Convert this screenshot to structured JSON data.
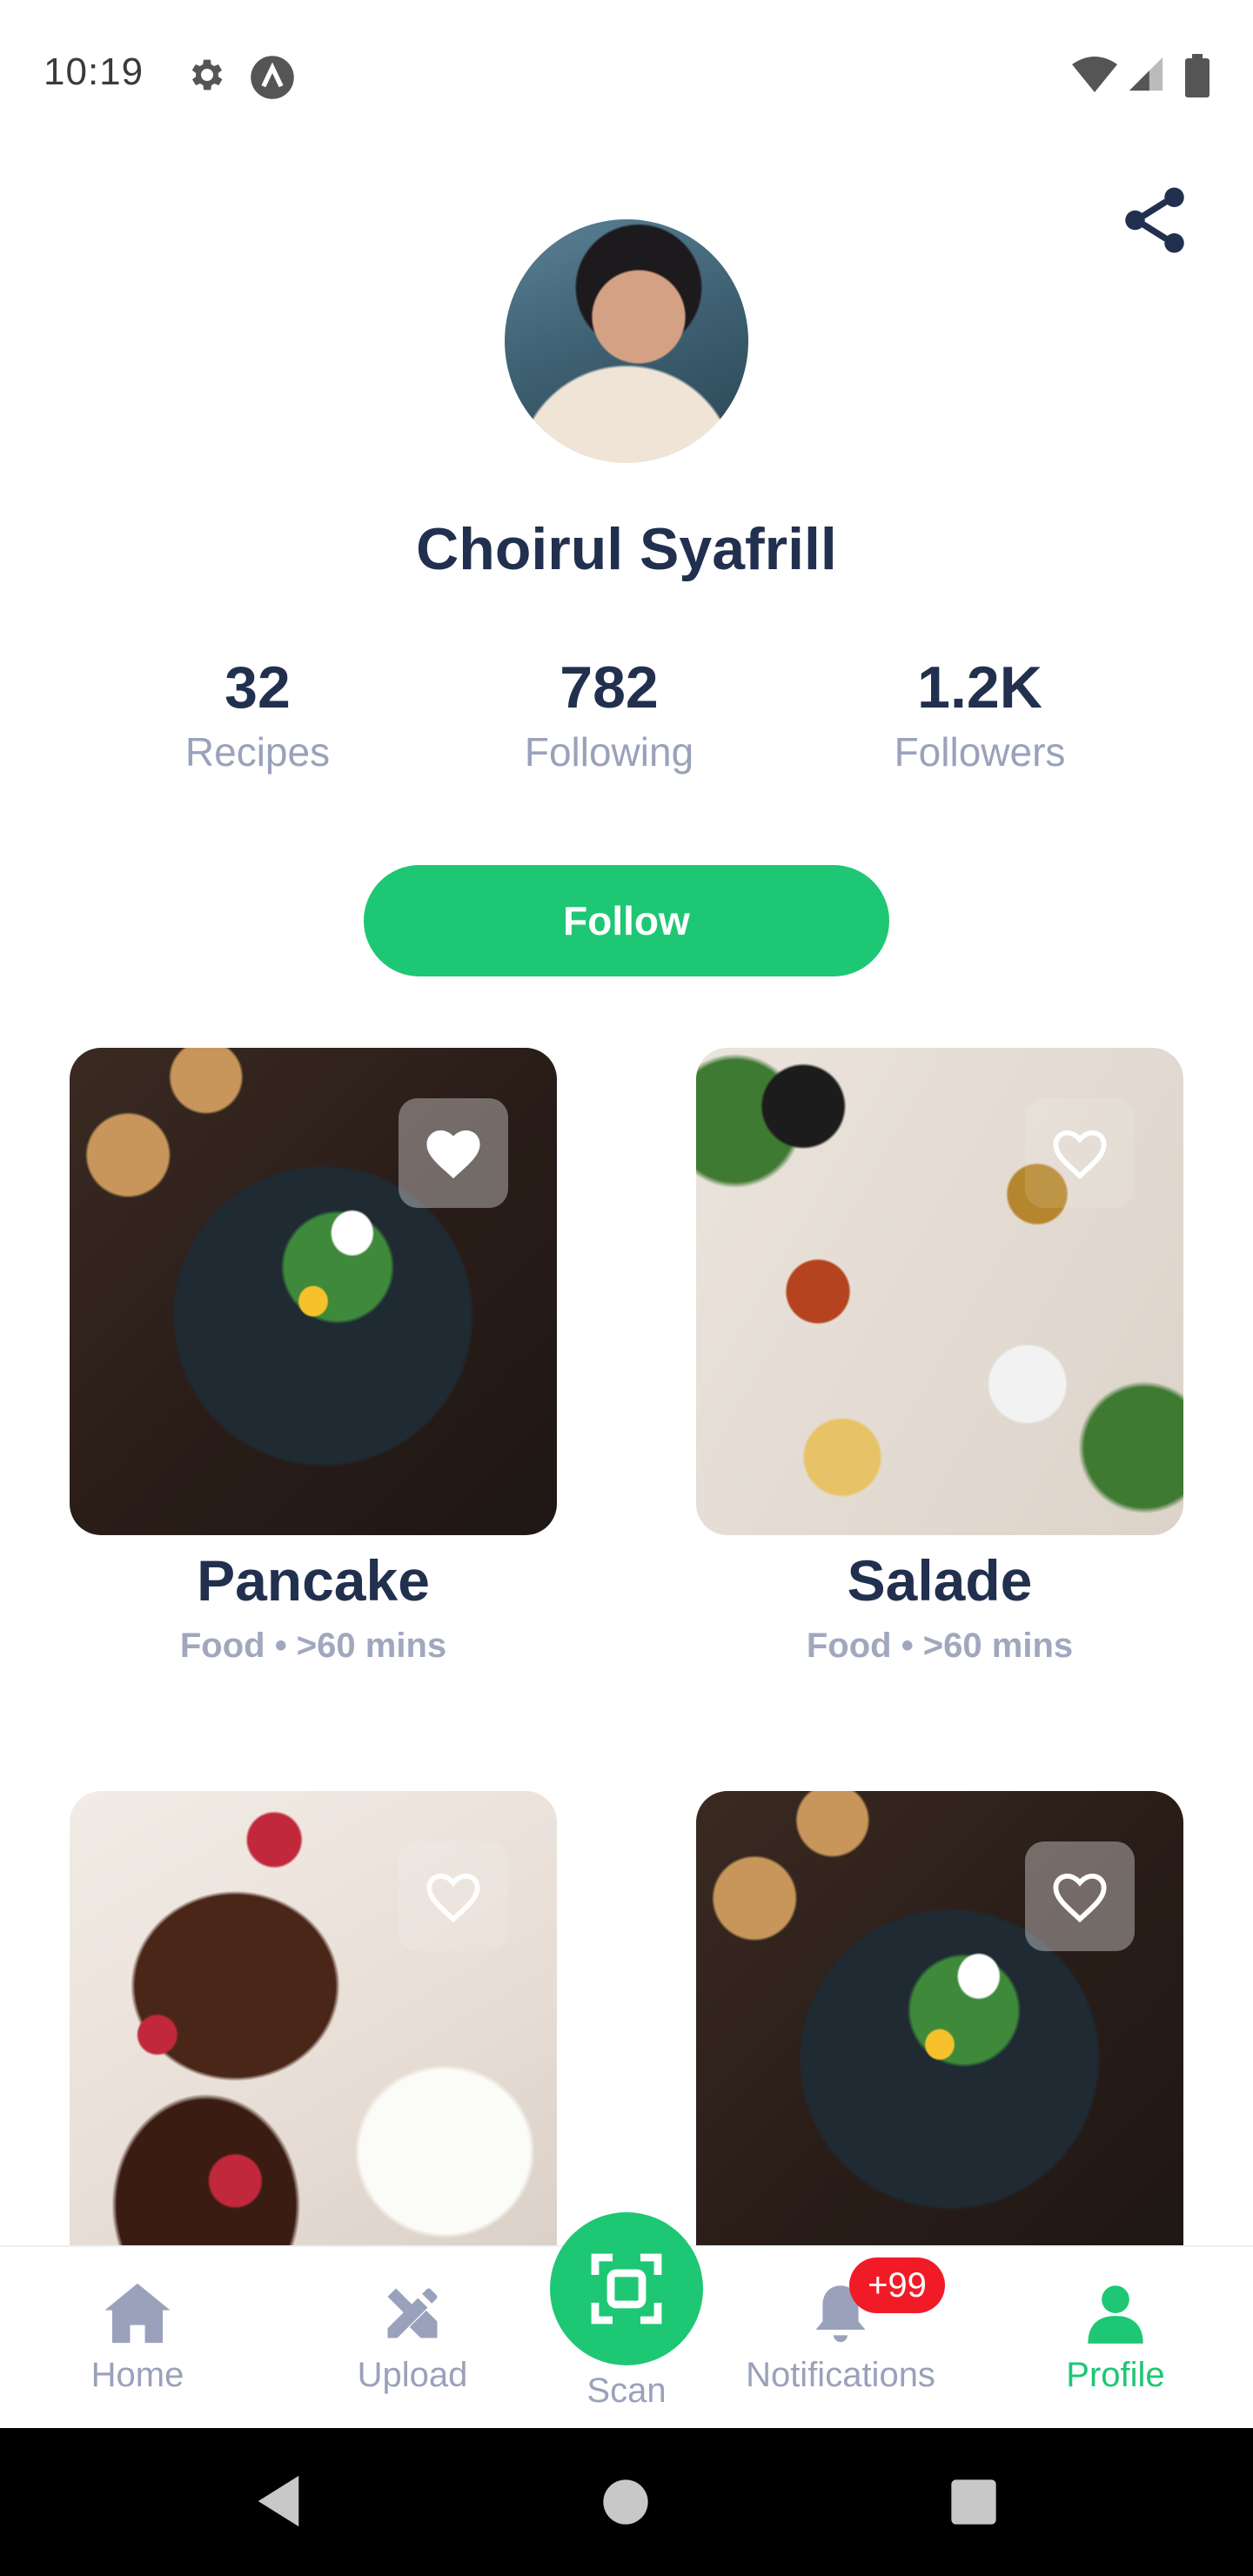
{
  "status_bar": {
    "time": "10:19",
    "icons": [
      "settings-gear-icon",
      "app-a-icon",
      "wifi-icon",
      "cell-signal-icon",
      "battery-icon"
    ]
  },
  "header": {
    "share_icon": "share-icon"
  },
  "profile": {
    "name": "Choirul Syafrill",
    "stats": [
      {
        "value": "32",
        "label": "Recipes"
      },
      {
        "value": "782",
        "label": "Following"
      },
      {
        "value": "1.2K",
        "label": "Followers"
      }
    ],
    "follow_label": "Follow"
  },
  "recipes": [
    {
      "title": "Pancake",
      "meta": "Food • >60 mins",
      "favorite": true
    },
    {
      "title": "Salade",
      "meta": "Food • >60 mins",
      "favorite": false
    },
    {
      "title": "",
      "meta": "",
      "favorite": false
    },
    {
      "title": "",
      "meta": "",
      "favorite": false
    }
  ],
  "bottom_nav": {
    "items": [
      {
        "label": "Home",
        "icon": "home-icon"
      },
      {
        "label": "Upload",
        "icon": "upload-pencil-icon"
      },
      {
        "label": "Scan",
        "icon": "scan-icon"
      },
      {
        "label": "Notifications",
        "icon": "bell-icon"
      },
      {
        "label": "Profile",
        "icon": "profile-icon"
      }
    ],
    "notification_badge": "+99",
    "active": "Profile"
  },
  "colors": {
    "accent": "#1ec774",
    "text_dark": "#22304f",
    "text_muted": "#9aa1bb",
    "badge": "#f11b28"
  }
}
